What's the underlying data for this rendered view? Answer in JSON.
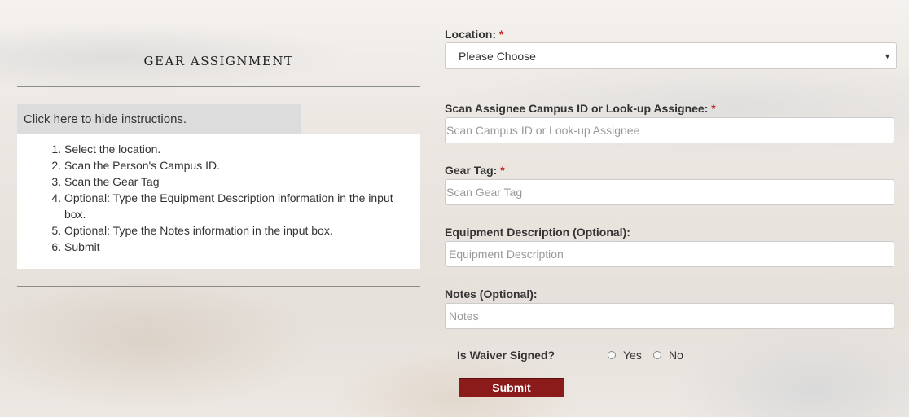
{
  "left": {
    "title": "GEAR ASSIGNMENT",
    "toggle_label": "Click here to hide instructions.",
    "instructions": [
      "Select the location.",
      "Scan the Person's Campus ID.",
      "Scan the Gear Tag",
      "Optional: Type the Equipment Description information in the input box.",
      "Optional: Type the Notes information in the input box.",
      "Submit"
    ]
  },
  "form": {
    "required_marker": "*",
    "location": {
      "label": "Location:",
      "value": "Please Choose"
    },
    "assignee": {
      "label": "Scan Assignee Campus ID or Look-up Assignee:",
      "placeholder": "Scan Campus ID or Look-up Assignee"
    },
    "gear_tag": {
      "label": "Gear Tag:",
      "placeholder": "Scan Gear Tag"
    },
    "equipment": {
      "label": "Equipment Description (Optional):",
      "placeholder": "Equipment Description"
    },
    "notes": {
      "label": "Notes (Optional):",
      "placeholder": "Notes"
    },
    "waiver": {
      "label": "Is Waiver Signed?",
      "options": [
        "Yes",
        "No"
      ]
    },
    "submit_label": "Submit"
  },
  "colors": {
    "accent": "#8b1a1a",
    "required": "#c62828",
    "instructions_toggle_bg": "#dcdcdc"
  },
  "icons": {
    "select_caret": "caret-down-icon"
  }
}
